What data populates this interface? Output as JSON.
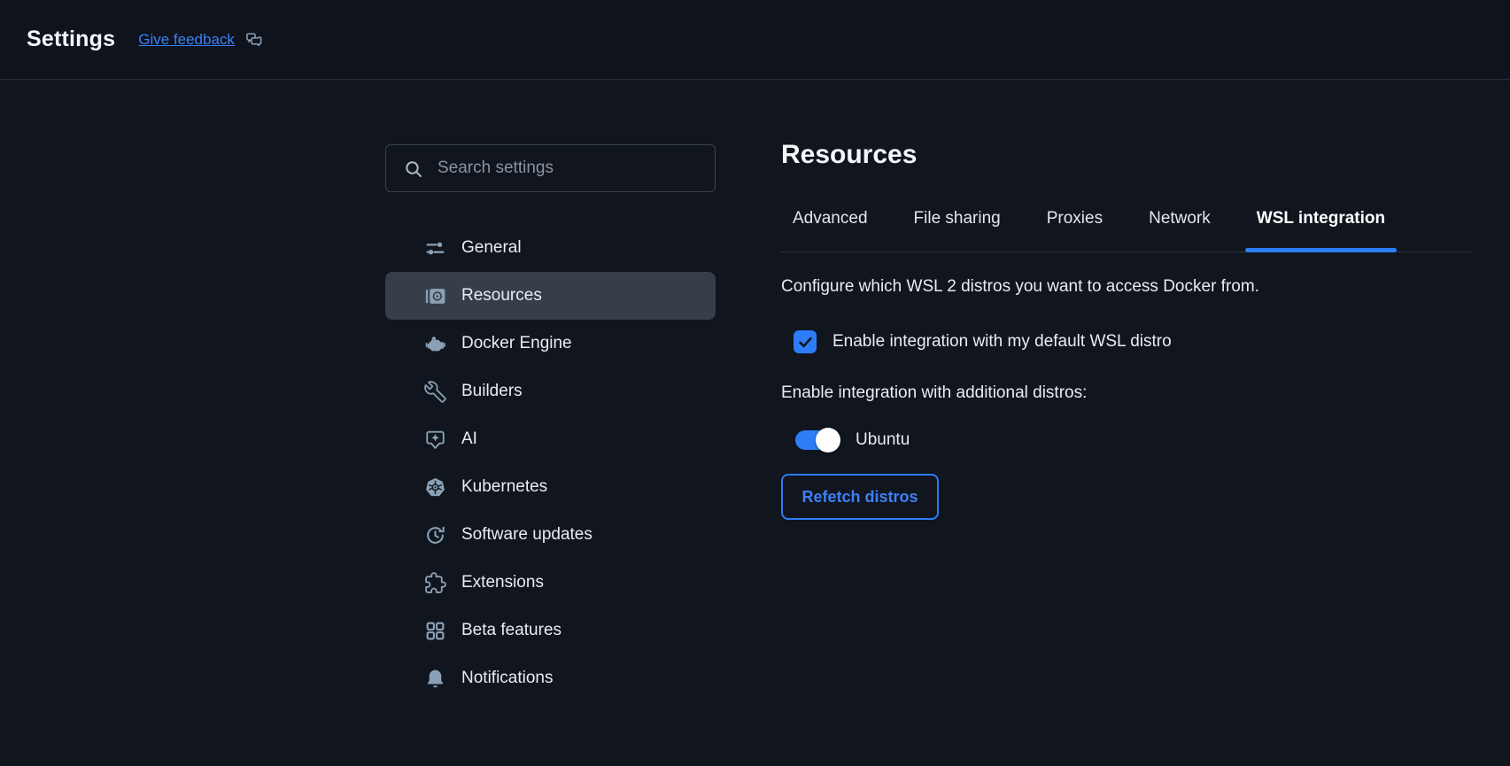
{
  "header": {
    "title": "Settings",
    "feedback_link": "Give feedback"
  },
  "sidebar": {
    "search_placeholder": "Search settings",
    "items": [
      {
        "label": "General",
        "icon": "sliders-icon",
        "selected": false
      },
      {
        "label": "Resources",
        "icon": "gauge-icon",
        "selected": true
      },
      {
        "label": "Docker Engine",
        "icon": "engine-icon",
        "selected": false
      },
      {
        "label": "Builders",
        "icon": "wrench-icon",
        "selected": false
      },
      {
        "label": "AI",
        "icon": "ai-sparkle-bubble-icon",
        "selected": false
      },
      {
        "label": "Kubernetes",
        "icon": "kubernetes-helm-icon",
        "selected": false
      },
      {
        "label": "Software updates",
        "icon": "clock-update-icon",
        "selected": false
      },
      {
        "label": "Extensions",
        "icon": "puzzle-icon",
        "selected": false
      },
      {
        "label": "Beta features",
        "icon": "grid-icon",
        "selected": false
      },
      {
        "label": "Notifications",
        "icon": "bell-icon",
        "selected": false
      }
    ]
  },
  "main": {
    "title": "Resources",
    "tabs": [
      {
        "label": "Advanced",
        "active": false
      },
      {
        "label": "File sharing",
        "active": false
      },
      {
        "label": "Proxies",
        "active": false
      },
      {
        "label": "Network",
        "active": false
      },
      {
        "label": "WSL integration",
        "active": true
      }
    ],
    "description": "Configure which WSL 2 distros you want to access Docker from.",
    "default_distro_checkbox": {
      "label": "Enable integration with my default WSL distro",
      "checked": true
    },
    "additional_distros_label": "Enable integration with additional distros:",
    "distros": [
      {
        "name": "Ubuntu",
        "enabled": true
      }
    ],
    "refetch_button": "Refetch distros"
  },
  "colors": {
    "accent": "#2e7cf6",
    "link": "#3d80f7",
    "bg": "#10151e",
    "header-bg": "#0e131c",
    "sel": "#373e4a",
    "icon": "#8aa0b5"
  }
}
